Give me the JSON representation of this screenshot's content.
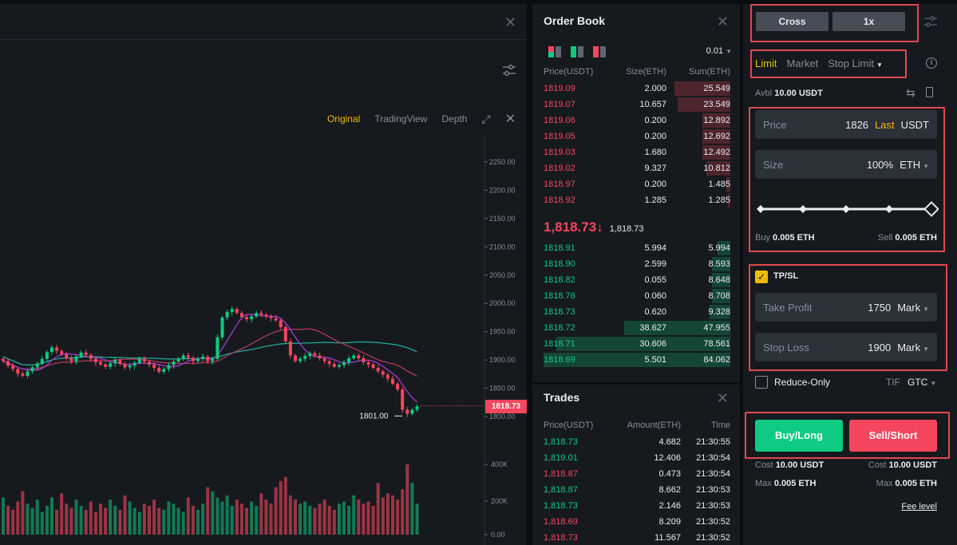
{
  "colors": {
    "bg": "#0b0e11",
    "panel": "#161a1e",
    "accent": "#f0b90b",
    "up": "#0ecb81",
    "down": "#f6465d",
    "muted": "#848e9c",
    "highlight": "#e0484e"
  },
  "chart": {
    "tabs": [
      "Original",
      "TradingView",
      "Depth"
    ],
    "active_tab": "Original",
    "price_axis": [
      "2250.00",
      "2200.00",
      "2150.00",
      "2100.00",
      "2050.00",
      "2000.00",
      "1950.00",
      "1900.00",
      "1850.00",
      "1800.00"
    ],
    "volume_axis": [
      "400K",
      "200K",
      "0.00"
    ],
    "low_label": "1801.00",
    "current_price": "1818.73",
    "close_series": [
      1898,
      1890,
      1884,
      1876,
      1872,
      1880,
      1887,
      1893,
      1902,
      1914,
      1922,
      1916,
      1910,
      1903,
      1898,
      1906,
      1913,
      1909,
      1902,
      1896,
      1892,
      1888,
      1894,
      1900,
      1893,
      1887,
      1890,
      1895,
      1902,
      1897,
      1892,
      1886,
      1879,
      1884,
      1891,
      1897,
      1902,
      1908,
      1904,
      1898,
      1902,
      1906,
      1898,
      1902,
      1940,
      1975,
      1985,
      1990,
      1983,
      1976,
      1972,
      1977,
      1983,
      1980,
      1977,
      1974,
      1970,
      1958,
      1933,
      1908,
      1898,
      1902,
      1907,
      1912,
      1908,
      1903,
      1898,
      1893,
      1888,
      1891,
      1896,
      1903,
      1908,
      1903,
      1896,
      1892,
      1886,
      1880,
      1874,
      1867,
      1858,
      1848,
      1812,
      1805,
      1812,
      1818
    ],
    "volume_series": [
      180,
      140,
      120,
      160,
      210,
      150,
      130,
      170,
      110,
      140,
      180,
      120,
      200,
      150,
      130,
      170,
      140,
      120,
      160,
      110,
      150,
      130,
      170,
      140,
      120,
      190,
      160,
      130,
      110,
      150,
      140,
      170,
      130,
      120,
      160,
      150,
      130,
      110,
      180,
      140,
      120,
      150,
      230,
      210,
      180,
      160,
      190,
      140,
      170,
      150,
      130,
      160,
      140,
      200,
      170,
      150,
      230,
      260,
      280,
      190,
      170,
      150,
      160,
      140,
      130,
      150,
      170,
      140,
      120,
      150,
      160,
      140,
      190,
      170,
      150,
      160,
      140,
      250,
      180,
      200,
      190,
      170,
      220,
      340,
      250,
      150
    ]
  },
  "order_book": {
    "title": "Order Book",
    "precision": "0.01",
    "headers": [
      "Price(USDT)",
      "Size(ETH)",
      "Sum(ETH)"
    ],
    "asks": [
      [
        "1819.09",
        "2.000",
        "25.549"
      ],
      [
        "1819.07",
        "10.657",
        "23.549"
      ],
      [
        "1819.06",
        "0.200",
        "12.892"
      ],
      [
        "1819.05",
        "0.200",
        "12.692"
      ],
      [
        "1819.03",
        "1.680",
        "12.492"
      ],
      [
        "1819.02",
        "9.327",
        "10.812"
      ],
      [
        "1818.97",
        "0.200",
        "1.485"
      ],
      [
        "1818.92",
        "1.285",
        "1.285"
      ]
    ],
    "ask_depth": [
      0.3,
      0.28,
      0.15,
      0.15,
      0.15,
      0.13,
      0.02,
      0.015
    ],
    "mid_price": "1,818.73",
    "mid_arrow": "↓",
    "mid_mark": "1,818.73",
    "bids": [
      [
        "1818.91",
        "5.994",
        "5.994"
      ],
      [
        "1818.90",
        "2.599",
        "8.593"
      ],
      [
        "1818.82",
        "0.055",
        "8.648"
      ],
      [
        "1818.76",
        "0.060",
        "8.708"
      ],
      [
        "1818.73",
        "0.620",
        "9.328"
      ],
      [
        "1818.72",
        "38.627",
        "47.955"
      ],
      [
        "1818.71",
        "30.606",
        "78.561"
      ],
      [
        "1818.69",
        "5.501",
        "84.062"
      ]
    ],
    "bid_depth": [
      0.07,
      0.1,
      0.1,
      0.1,
      0.11,
      0.57,
      0.93,
      1.0
    ]
  },
  "trades": {
    "title": "Trades",
    "headers": [
      "Price(USDT)",
      "Amount(ETH)",
      "Time"
    ],
    "rows": [
      [
        "1,818.73",
        "4.682",
        "21:30:55",
        "up"
      ],
      [
        "1,819.01",
        "12.406",
        "21:30:54",
        "up"
      ],
      [
        "1,818.87",
        "0.473",
        "21:30:54",
        "down"
      ],
      [
        "1,818.87",
        "8.662",
        "21:30:53",
        "up"
      ],
      [
        "1,818.73",
        "2.146",
        "21:30:53",
        "up"
      ],
      [
        "1,818.69",
        "8.209",
        "21:30:52",
        "down"
      ],
      [
        "1,818.73",
        "11.567",
        "21:30:52",
        "down"
      ]
    ]
  },
  "order_form": {
    "margin_mode": "Cross",
    "leverage": "1x",
    "tabs": [
      "Limit",
      "Market",
      "Stop Limit"
    ],
    "active_tab": "Limit",
    "avbl_label": "Avbl",
    "avbl_value": "10.00 USDT",
    "price_label": "Price",
    "price_value": "1826",
    "price_source": "Last",
    "price_unit": "USDT",
    "size_label": "Size",
    "size_value": "100%",
    "size_unit": "ETH",
    "slider_fraction": 1.0,
    "buy_label": "Buy",
    "buy_amount": "0.005 ETH",
    "sell_label": "Sell",
    "sell_amount": "0.005 ETH",
    "tpsl_label": "TP/SL",
    "tpsl_checked": true,
    "take_profit_label": "Take Profit",
    "take_profit_value": "1750",
    "take_profit_unit": "Mark",
    "stop_loss_label": "Stop Loss",
    "stop_loss_value": "1900",
    "stop_loss_unit": "Mark",
    "reduce_only_label": "Reduce-Only",
    "tif_label": "TIF",
    "tif_value": "GTC",
    "buy_button": "Buy/Long",
    "sell_button": "Sell/Short",
    "cost_label": "Cost",
    "buy_cost": "10.00 USDT",
    "sell_cost": "10.00 USDT",
    "max_label": "Max",
    "buy_max": "0.005 ETH",
    "sell_max": "0.005 ETH",
    "fee_level": "Fee level"
  }
}
